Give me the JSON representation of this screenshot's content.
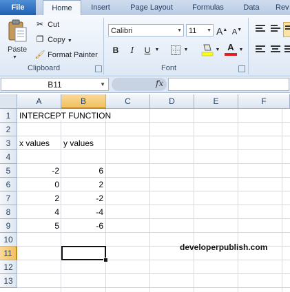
{
  "ribbon": {
    "tabs": [
      "File",
      "Home",
      "Insert",
      "Page Layout",
      "Formulas",
      "Data",
      "Rev"
    ],
    "clipboard": {
      "paste_label": "Paste",
      "cut_label": "Cut",
      "copy_label": "Copy",
      "format_painter_label": "Format Painter",
      "group_label": "Clipboard"
    },
    "font": {
      "font_name": "Calibri",
      "font_size": "11",
      "group_label": "Font",
      "bold": "B",
      "italic": "I",
      "underline": "U",
      "grow": "A",
      "shrink": "A",
      "font_color_letter": "A",
      "fill_color": "#ffff00",
      "font_color": "#e02020"
    }
  },
  "formula_bar": {
    "name_box": "B11",
    "fx": "fx",
    "formula": ""
  },
  "sheet": {
    "columns": [
      "A",
      "B",
      "C",
      "D",
      "E",
      "F"
    ],
    "rows": [
      "1",
      "2",
      "3",
      "4",
      "5",
      "6",
      "7",
      "8",
      "9",
      "10",
      "11",
      "12",
      "13"
    ],
    "selected_column": "B",
    "selected_row": "11",
    "title": "INTERCEPT FUNCTION",
    "x_header": "x values",
    "y_header": "y values",
    "data": [
      {
        "x": "-2",
        "y": "6"
      },
      {
        "x": "0",
        "y": "2"
      },
      {
        "x": "2",
        "y": "-2"
      },
      {
        "x": "4",
        "y": "-4"
      },
      {
        "x": "5",
        "y": "-6"
      }
    ]
  },
  "watermark": "developerpublish.com"
}
